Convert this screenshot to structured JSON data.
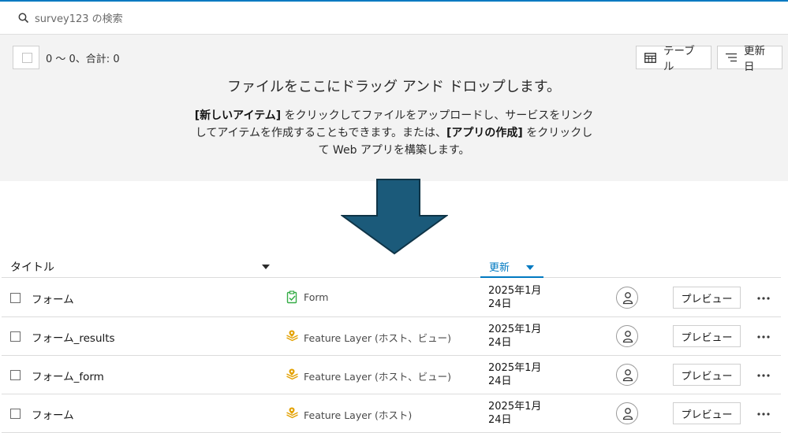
{
  "search": {
    "placeholder": "survey123 の検索",
    "icon": "search-icon"
  },
  "toolbar": {
    "count_text": "0 〜 0、合計: 0",
    "table_label": "テーブル",
    "sort_label": "更新日"
  },
  "dropzone": {
    "title": "ファイルをここにドラッグ アンド ドロップします。",
    "line1_bold1": "[新しいアイテム]",
    "line1_rest": " をクリックしてファイルをアップロードし、サービスをリンク",
    "line2_pre": "してアイテムを作成することもできます。または、",
    "line2_bold": "[アプリの作成]",
    "line2_rest": " をクリックし",
    "line3": "て Web アプリを構築します。"
  },
  "colors": {
    "accent": "#0079c1",
    "arrow": "#1b5a7a",
    "form_icon": "#35ac46",
    "layer_icon": "#e3a100"
  },
  "table": {
    "col_title": "タイトル",
    "col_updated": "更新",
    "rows": [
      {
        "name": "フォーム",
        "type": "Form",
        "type_icon": "form-icon",
        "date_line1": "2025年1月",
        "date_line2": "24日",
        "preview": "プレビュー"
      },
      {
        "name": "フォーム_results",
        "type": "Feature Layer (ホスト、ビュー)",
        "type_icon": "feature-layer-icon",
        "date_line1": "2025年1月",
        "date_line2": "24日",
        "preview": "プレビュー"
      },
      {
        "name": "フォーム_form",
        "type": "Feature Layer (ホスト、ビュー)",
        "type_icon": "feature-layer-icon",
        "date_line1": "2025年1月",
        "date_line2": "24日",
        "preview": "プレビュー"
      },
      {
        "name": "フォーム",
        "type": "Feature Layer (ホスト)",
        "type_icon": "feature-layer-icon",
        "date_line1": "2025年1月",
        "date_line2": "24日",
        "preview": "プレビュー"
      }
    ]
  }
}
